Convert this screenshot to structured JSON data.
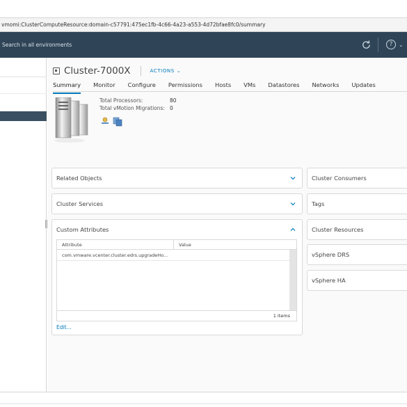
{
  "browser": {
    "url": "vmomi:ClusterComputeResource:domain-c57791:475ec1fb-4c66-4a23-a553-4d72bfae8fc0/summary"
  },
  "header": {
    "search_placeholder": "Search in all environments",
    "icons": [
      "refresh-icon",
      "help-icon",
      "chevron-down-icon"
    ]
  },
  "object": {
    "title": "Cluster-7000X",
    "actions_label": "ACTIONS"
  },
  "tabs": [
    {
      "label": "Summary",
      "active": true
    },
    {
      "label": "Monitor"
    },
    {
      "label": "Configure"
    },
    {
      "label": "Permissions"
    },
    {
      "label": "Hosts"
    },
    {
      "label": "VMs"
    },
    {
      "label": "Datastores"
    },
    {
      "label": "Networks"
    },
    {
      "label": "Updates"
    }
  ],
  "summary": {
    "processors_label": "Total Processors:",
    "processors_value": "80",
    "vmotion_label": "Total vMotion Migrations:",
    "vmotion_value": "0"
  },
  "left_cards": {
    "related_objects": "Related Objects",
    "cluster_services": "Cluster Services",
    "custom_attributes": "Custom Attributes"
  },
  "attributes_table": {
    "headers": [
      "Attribute",
      "Value"
    ],
    "rows": [
      {
        "attribute": "com.vmware.vcenter.cluster.edrs.upgradeHo...",
        "value": ""
      }
    ],
    "footer": "1 items",
    "edit_label": "Edit..."
  },
  "right_cards": [
    "Cluster Consumers",
    "Tags",
    "Cluster Resources",
    "vSphere DRS",
    "vSphere HA"
  ],
  "colors": {
    "header_bg": "#2f4557",
    "accent": "#0079b8"
  }
}
